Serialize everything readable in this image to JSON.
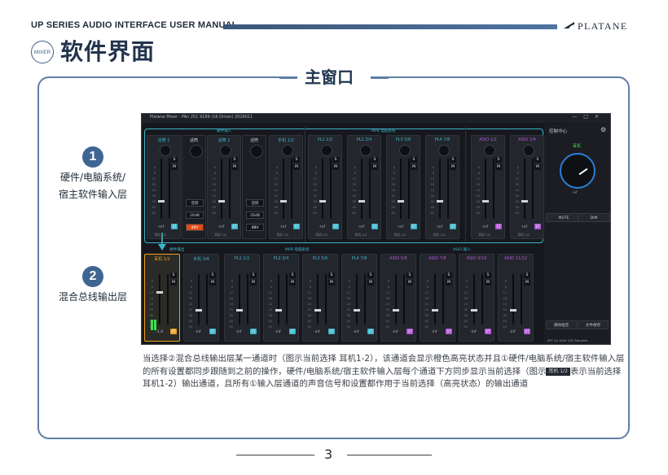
{
  "header": {
    "manual_title": "UP SERIES AUDIO INTERFACE USER MANUAL",
    "brand": "PLATANE",
    "badge": "MIXER",
    "section_title": "软件界面",
    "header_bar_color": "#4a6d97"
  },
  "panel": {
    "title": "主窗口",
    "layers": [
      {
        "number": "1",
        "label_lines": [
          "硬件/电脑系统/",
          "宿主软件输入层"
        ]
      },
      {
        "number": "2",
        "label_lines": [
          "混合总线输出层"
        ]
      }
    ],
    "caption_parts": {
      "p1": "当选择②混合总线输出层某一通道时（图示当前选择 耳机1-2），该通道会显示橙色高亮状态并且①硬件/电脑系统/宿主软件输入层的所有设置都同步跟随到之前的操作，硬件/电脑系统/宿主软件输入层每个通道下方同步显示当前选择（图示",
      "tag": "耳机 1/2",
      "p2": "表示当前选择 耳机1-2）输出通道，且所有①输入层通道的声音信号和设置都作用于当前选择（高亮状态）的输出通道"
    }
  },
  "app": {
    "window_title": "Platane Mixer - PAn 251 9189 (16 Driver) 2026011",
    "control_center": "控制中心",
    "input_groups": [
      {
        "title": "硬件输入",
        "color": "#3db4c9"
      },
      {
        "title": "MPB 电脑系统",
        "color": "#3db4c9"
      }
    ],
    "input_channels": [
      {
        "name": "话筒 1",
        "color": "#3db4c9",
        "out": "耳机 1/2",
        "tag": "ST"
      },
      {
        "name": "话筒 2",
        "color": "#3db4c9",
        "out": "耳机 1/2",
        "tag": "ST"
      },
      {
        "name": "手机 1/2",
        "color": "#3db4c9",
        "out": "耳机 1/2",
        "tag": "ST"
      },
      {
        "name": "PL1 1/2",
        "color": "#3db4c9",
        "out": "耳机 1/2",
        "tag": "ST"
      },
      {
        "name": "PL2 3/4",
        "color": "#3db4c9",
        "out": "耳机 1/2",
        "tag": "ST"
      },
      {
        "name": "PL3 5/6",
        "color": "#3db4c9",
        "out": "耳机 1/2",
        "tag": "ST"
      },
      {
        "name": "PL4 7/8",
        "color": "#3db4c9",
        "out": "耳机 1/2",
        "tag": "ST"
      },
      {
        "name": "ASIO 1/2",
        "color": "#b257d8",
        "out": "耳机 1/2",
        "tag": "ST"
      },
      {
        "name": "ASIO 3/4",
        "color": "#b257d8",
        "out": "耳机 1/2",
        "tag": "ST"
      }
    ],
    "mic_controls": {
      "label": "话筒",
      "gain": "26dB",
      "phantom": "48V"
    },
    "side": {
      "monitor_title": "耳机",
      "mute": "MUTE",
      "dim": "DIM",
      "clear": "清除哑音",
      "save": "文件保存",
      "status": "SPF 44.1kHz  192 Samples"
    },
    "output_groups": [
      {
        "title": "硬件输出"
      },
      {
        "title": "MPB 电脑系统"
      },
      {
        "title": "ASIO 输入"
      }
    ],
    "output_channels": [
      {
        "name": "耳机 1/2",
        "color": "#f0a020",
        "selected": true,
        "tag": "ST"
      },
      {
        "name": "手机 3/4",
        "color": "#3db4c9",
        "selected": false,
        "tag": "ST"
      },
      {
        "name": "PL1 1/2",
        "color": "#3db4c9",
        "selected": false,
        "tag": "ST"
      },
      {
        "name": "PL2 3/4",
        "color": "#3db4c9",
        "selected": false,
        "tag": "ST"
      },
      {
        "name": "PL3 5/6",
        "color": "#3db4c9",
        "selected": false,
        "tag": "ST"
      },
      {
        "name": "PL4 7/8",
        "color": "#3db4c9",
        "selected": false,
        "tag": "ST"
      },
      {
        "name": "ASIO 5/6",
        "color": "#b257d8",
        "selected": false,
        "tag": "ST"
      },
      {
        "name": "ASIO 7/8",
        "color": "#b257d8",
        "selected": false,
        "tag": "ST"
      },
      {
        "name": "ASIO 9/10",
        "color": "#b257d8",
        "selected": false,
        "tag": "ST"
      },
      {
        "name": "ASIO 11/12",
        "color": "#b257d8",
        "selected": false,
        "tag": "ST"
      }
    ],
    "fader_value": "-inf",
    "selected_value": "-1.0",
    "scale_marks": [
      "0",
      "6",
      "12",
      "18",
      "24",
      "30",
      "36",
      "48",
      "60"
    ]
  },
  "footer": {
    "page_number": "3"
  }
}
